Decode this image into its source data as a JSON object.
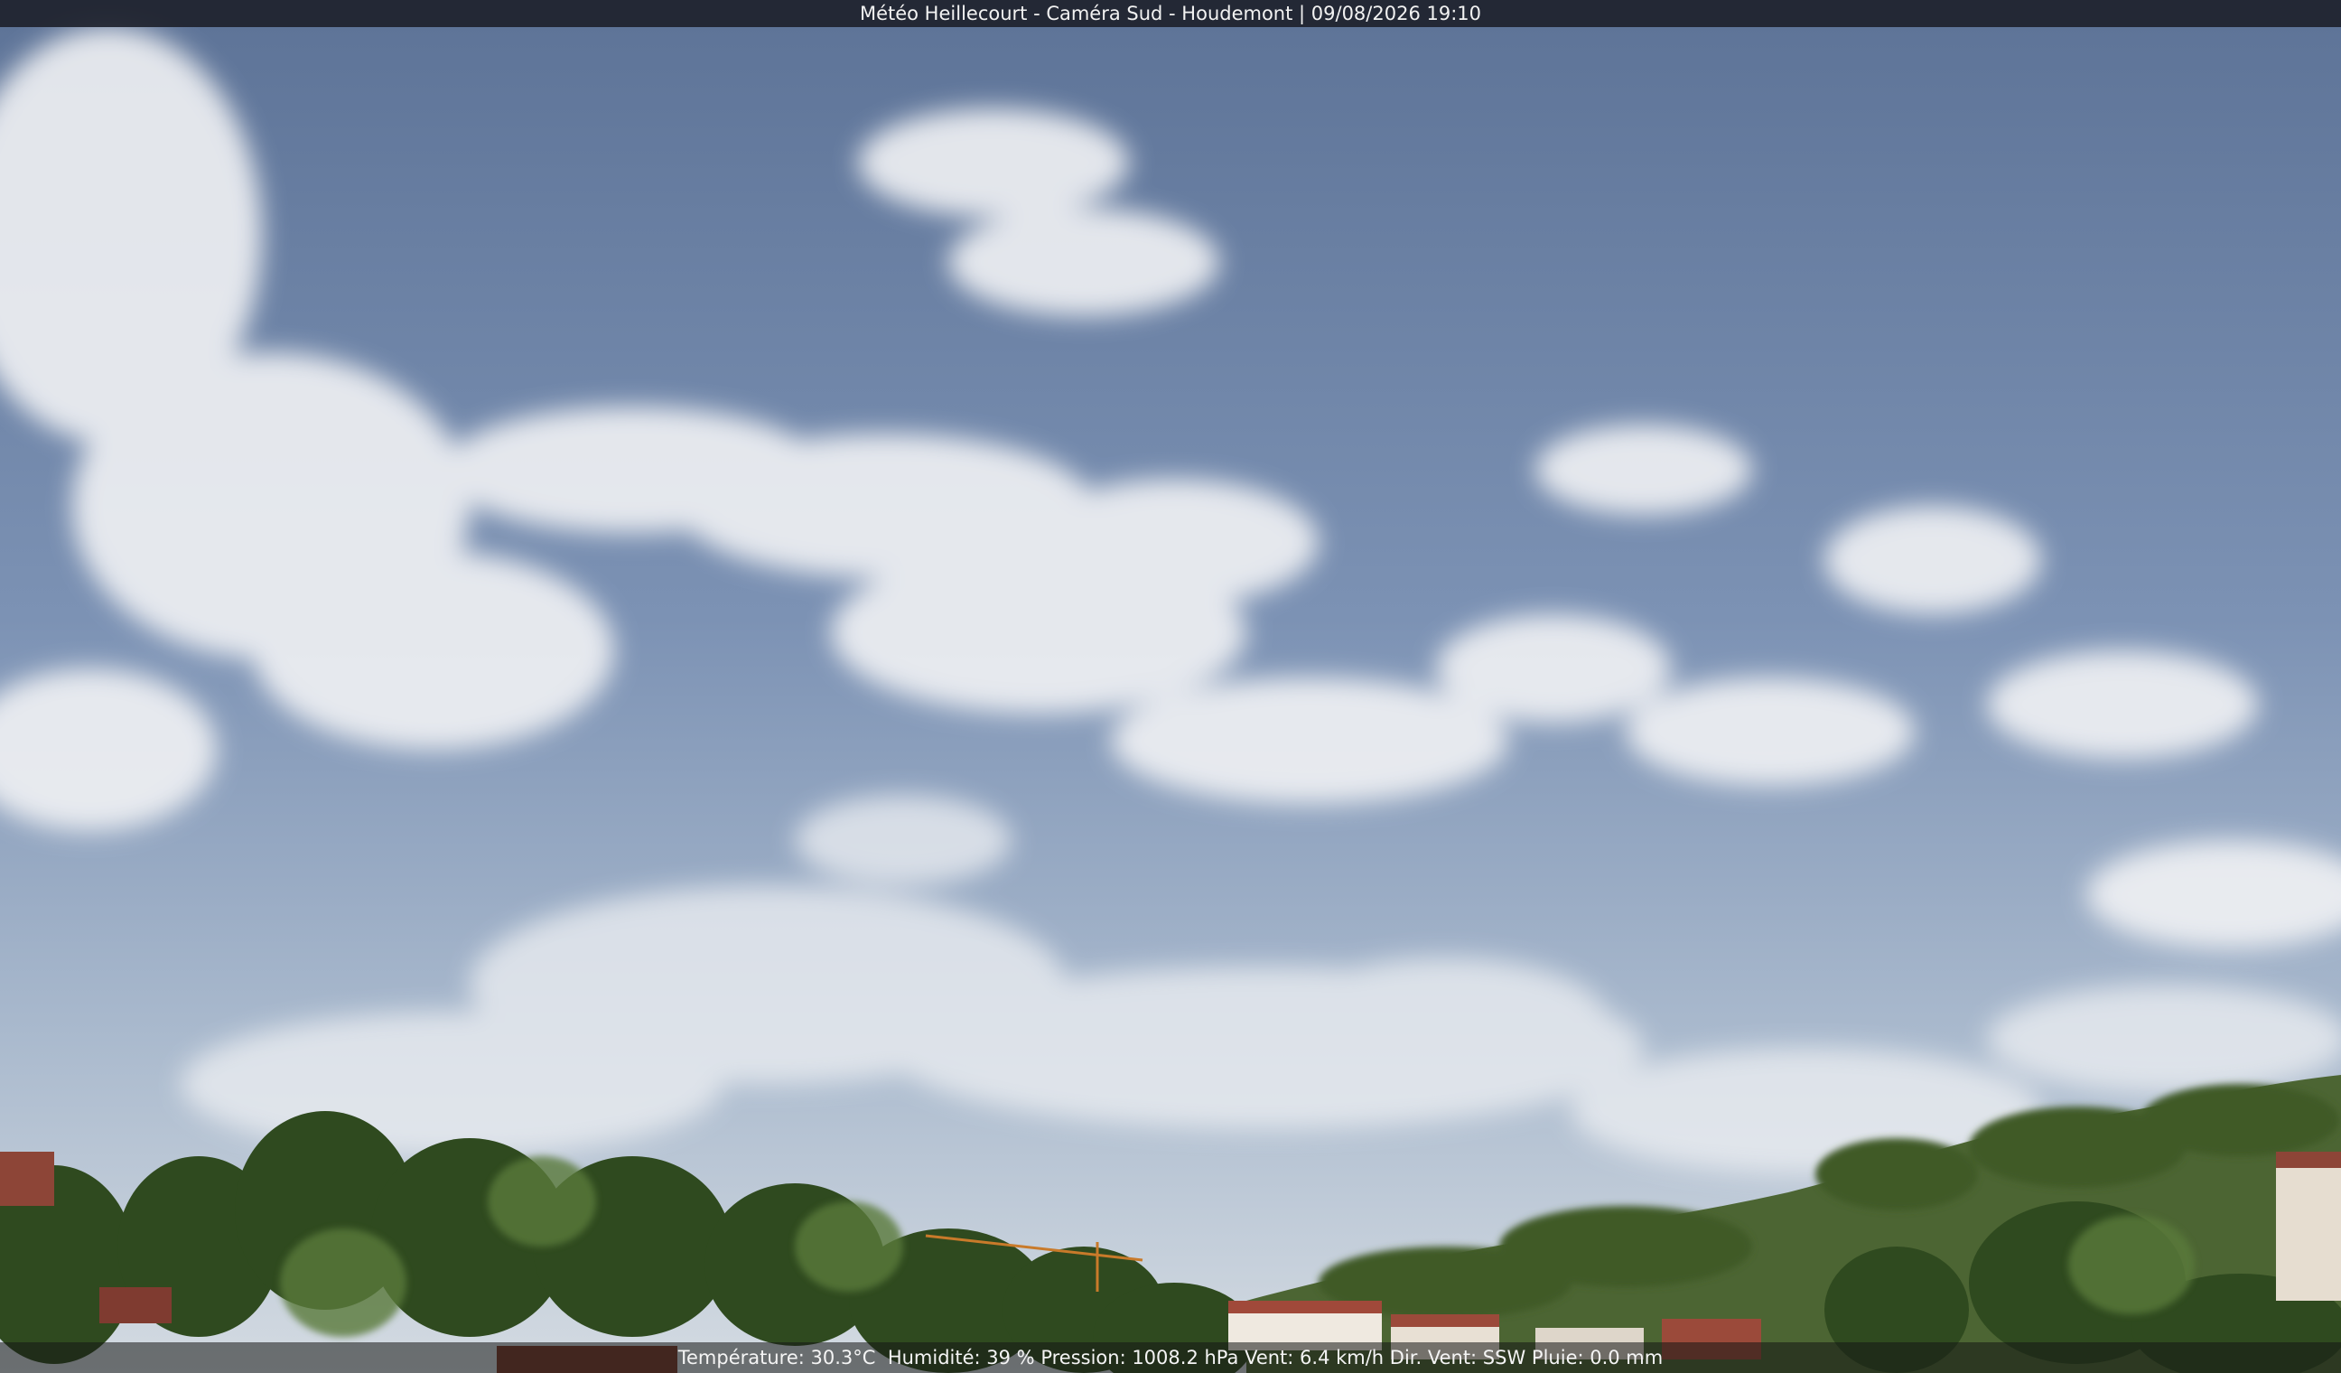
{
  "overlay": {
    "title": "Météo Heillecourt - Caméra Sud - Houdemont | 09/08/2026 19:10",
    "weather": {
      "temperature": "Température: 30.3°C",
      "humidity": "Humidité: 39 %",
      "pressure": "Pression: 1008.2 hPa",
      "wind": "Vent: 6.4 km/h",
      "wind_direction": "Dir. Vent: SSW",
      "rain": "Pluie: 0.0 mm"
    }
  },
  "colors": {
    "sky_top": "#5e7498",
    "sky_mid": "#7f94b5",
    "sky_horizon": "#c9d3de",
    "cloud": "#f2f3f5",
    "hill": "#4f6a36",
    "trees": "#2f4a1e",
    "roof": "#9b4a3a"
  }
}
